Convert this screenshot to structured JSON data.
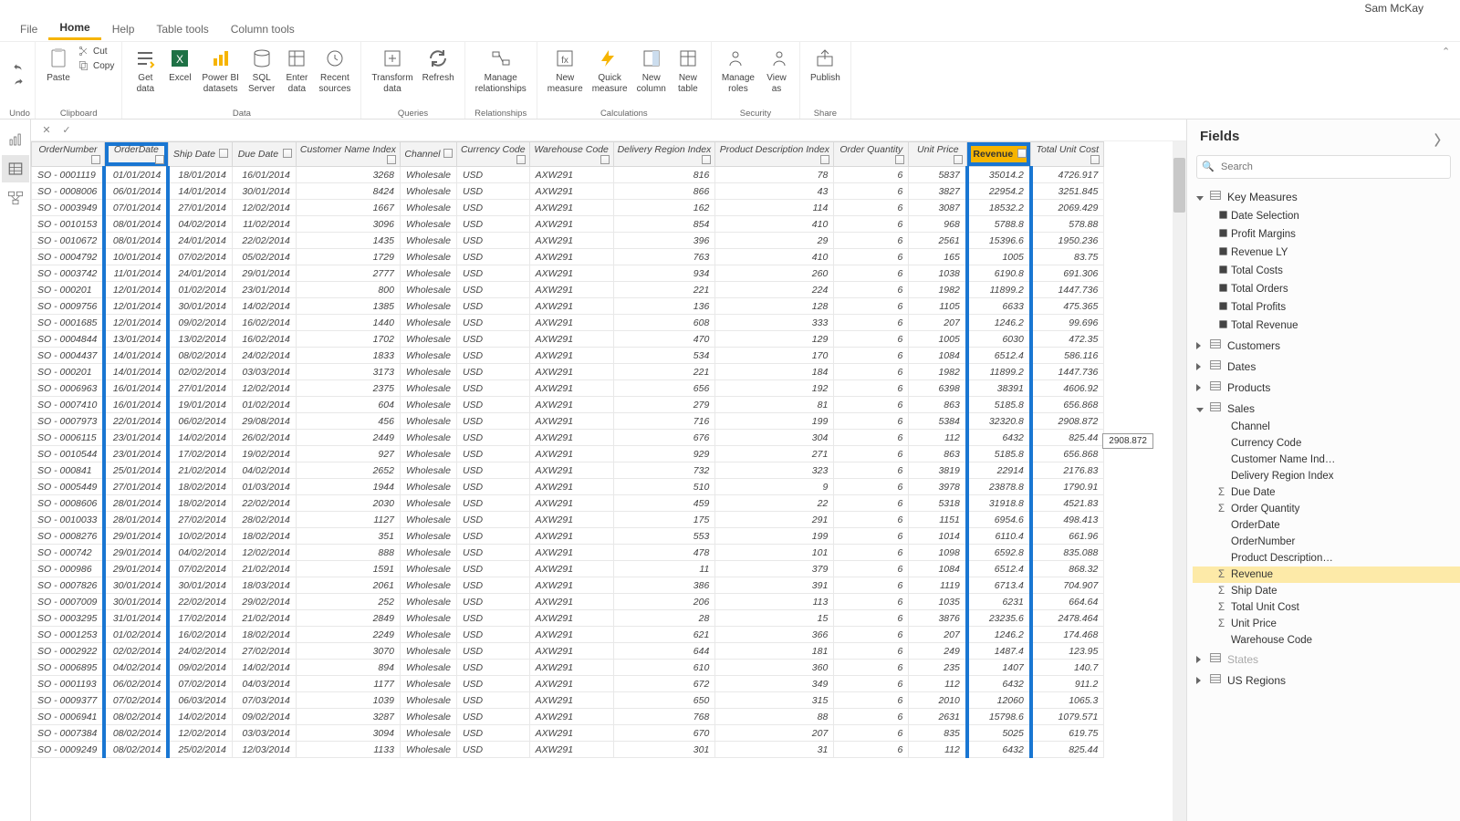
{
  "user": "Sam McKay",
  "menu": {
    "tabs": [
      "File",
      "Home",
      "Help",
      "Table tools",
      "Column tools"
    ],
    "active": 1
  },
  "ribbon": {
    "undo": {
      "label": "Undo"
    },
    "clipboard": {
      "label": "Clipboard",
      "paste": "Paste",
      "cut": "Cut",
      "copy": "Copy"
    },
    "data": {
      "label": "Data",
      "get": "Get\ndata",
      "excel": "Excel",
      "pbids": "Power BI\ndatasets",
      "sql": "SQL\nServer",
      "enter": "Enter\ndata",
      "recent": "Recent\nsources"
    },
    "queries": {
      "label": "Queries",
      "transform": "Transform\ndata",
      "refresh": "Refresh"
    },
    "rel": {
      "label": "Relationships",
      "manage": "Manage\nrelationships"
    },
    "calc": {
      "label": "Calculations",
      "nm": "New\nmeasure",
      "qm": "Quick\nmeasure",
      "nc": "New\ncolumn",
      "nt": "New\ntable"
    },
    "sec": {
      "label": "Security",
      "mr": "Manage\nroles",
      "va": "View\nas"
    },
    "share": {
      "label": "Share",
      "pub": "Publish"
    }
  },
  "fields": {
    "title": "Fields",
    "search_ph": "Search",
    "tables": [
      {
        "name": "Key Measures",
        "open": true,
        "items": [
          "Date Selection",
          "Profit Margins",
          "Revenue LY",
          "Total Costs",
          "Total Orders",
          "Total Profits",
          "Total Revenue"
        ]
      },
      {
        "name": "Customers",
        "open": false
      },
      {
        "name": "Dates",
        "open": false
      },
      {
        "name": "Products",
        "open": false
      },
      {
        "name": "Sales",
        "open": true,
        "items": [
          "Channel",
          "Currency Code",
          "Customer Name Ind…",
          "Delivery Region Index",
          "Due Date",
          "Order Quantity",
          "OrderDate",
          "OrderNumber",
          "Product Description…",
          "Revenue",
          "Ship Date",
          "Total Unit Cost",
          "Unit Price",
          "Warehouse Code"
        ],
        "sel": "Revenue",
        "sigma": [
          "Due Date",
          "Order Quantity",
          "Revenue",
          "Ship Date",
          "Total Unit Cost",
          "Unit Price"
        ]
      },
      {
        "name": "States",
        "open": false,
        "dim": true
      },
      {
        "name": "US Regions",
        "open": false
      }
    ]
  },
  "tooltip": "2908.872",
  "columns": [
    "OrderNumber",
    "OrderDate",
    "Ship Date",
    "Due Date",
    "Customer Name Index",
    "Channel",
    "Currency Code",
    "Warehouse Code",
    "Delivery Region Index",
    "Product Description Index",
    "Order Quantity",
    "Unit Price",
    "Revenue",
    "Total Unit Cost"
  ],
  "hl_cols": [
    1,
    12
  ],
  "hl_header_bg": 12,
  "chart_data": {
    "type": "table",
    "note": "raw sales rows shown in Power BI data view"
  },
  "rows": [
    [
      "SO - 0001119",
      "01/01/2014",
      "18/01/2014",
      "16/01/2014",
      "3268",
      "Wholesale",
      "USD",
      "AXW291",
      "816",
      "78",
      "6",
      "5837",
      "35014.2",
      "4726.917"
    ],
    [
      "SO - 0008006",
      "06/01/2014",
      "14/01/2014",
      "30/01/2014",
      "8424",
      "Wholesale",
      "USD",
      "AXW291",
      "866",
      "43",
      "6",
      "3827",
      "22954.2",
      "3251.845"
    ],
    [
      "SO - 0003949",
      "07/01/2014",
      "27/01/2014",
      "12/02/2014",
      "1667",
      "Wholesale",
      "USD",
      "AXW291",
      "162",
      "114",
      "6",
      "3087",
      "18532.2",
      "2069.429"
    ],
    [
      "SO - 0010153",
      "08/01/2014",
      "04/02/2014",
      "11/02/2014",
      "3096",
      "Wholesale",
      "USD",
      "AXW291",
      "854",
      "410",
      "6",
      "968",
      "5788.8",
      "578.88"
    ],
    [
      "SO - 0010672",
      "08/01/2014",
      "24/01/2014",
      "22/02/2014",
      "1435",
      "Wholesale",
      "USD",
      "AXW291",
      "396",
      "29",
      "6",
      "2561",
      "15396.6",
      "1950.236"
    ],
    [
      "SO - 0004792",
      "10/01/2014",
      "07/02/2014",
      "05/02/2014",
      "1729",
      "Wholesale",
      "USD",
      "AXW291",
      "763",
      "410",
      "6",
      "165",
      "1005",
      "83.75"
    ],
    [
      "SO - 0003742",
      "11/01/2014",
      "24/01/2014",
      "29/01/2014",
      "2777",
      "Wholesale",
      "USD",
      "AXW291",
      "934",
      "260",
      "6",
      "1038",
      "6190.8",
      "691.306"
    ],
    [
      "SO - 000201",
      "12/01/2014",
      "01/02/2014",
      "23/01/2014",
      "800",
      "Wholesale",
      "USD",
      "AXW291",
      "221",
      "224",
      "6",
      "1982",
      "11899.2",
      "1447.736"
    ],
    [
      "SO - 0009756",
      "12/01/2014",
      "30/01/2014",
      "14/02/2014",
      "1385",
      "Wholesale",
      "USD",
      "AXW291",
      "136",
      "128",
      "6",
      "1105",
      "6633",
      "475.365"
    ],
    [
      "SO - 0001685",
      "12/01/2014",
      "09/02/2014",
      "16/02/2014",
      "1440",
      "Wholesale",
      "USD",
      "AXW291",
      "608",
      "333",
      "6",
      "207",
      "1246.2",
      "99.696"
    ],
    [
      "SO - 0004844",
      "13/01/2014",
      "13/02/2014",
      "16/02/2014",
      "1702",
      "Wholesale",
      "USD",
      "AXW291",
      "470",
      "129",
      "6",
      "1005",
      "6030",
      "472.35"
    ],
    [
      "SO - 0004437",
      "14/01/2014",
      "08/02/2014",
      "24/02/2014",
      "1833",
      "Wholesale",
      "USD",
      "AXW291",
      "534",
      "170",
      "6",
      "1084",
      "6512.4",
      "586.116"
    ],
    [
      "SO - 000201",
      "14/01/2014",
      "02/02/2014",
      "03/03/2014",
      "3173",
      "Wholesale",
      "USD",
      "AXW291",
      "221",
      "184",
      "6",
      "1982",
      "11899.2",
      "1447.736"
    ],
    [
      "SO - 0006963",
      "16/01/2014",
      "27/01/2014",
      "12/02/2014",
      "2375",
      "Wholesale",
      "USD",
      "AXW291",
      "656",
      "192",
      "6",
      "6398",
      "38391",
      "4606.92"
    ],
    [
      "SO - 0007410",
      "16/01/2014",
      "19/01/2014",
      "01/02/2014",
      "604",
      "Wholesale",
      "USD",
      "AXW291",
      "279",
      "81",
      "6",
      "863",
      "5185.8",
      "656.868"
    ],
    [
      "SO - 0007973",
      "22/01/2014",
      "06/02/2014",
      "29/08/2014",
      "456",
      "Wholesale",
      "USD",
      "AXW291",
      "716",
      "199",
      "6",
      "5384",
      "32320.8",
      "2908.872"
    ],
    [
      "SO - 0006115",
      "23/01/2014",
      "14/02/2014",
      "26/02/2014",
      "2449",
      "Wholesale",
      "USD",
      "AXW291",
      "676",
      "304",
      "6",
      "112",
      "6432",
      "825.44"
    ],
    [
      "SO - 0010544",
      "23/01/2014",
      "17/02/2014",
      "19/02/2014",
      "927",
      "Wholesale",
      "USD",
      "AXW291",
      "929",
      "271",
      "6",
      "863",
      "5185.8",
      "656.868"
    ],
    [
      "SO - 000841",
      "25/01/2014",
      "21/02/2014",
      "04/02/2014",
      "2652",
      "Wholesale",
      "USD",
      "AXW291",
      "732",
      "323",
      "6",
      "3819",
      "22914",
      "2176.83"
    ],
    [
      "SO - 0005449",
      "27/01/2014",
      "18/02/2014",
      "01/03/2014",
      "1944",
      "Wholesale",
      "USD",
      "AXW291",
      "510",
      "9",
      "6",
      "3978",
      "23878.8",
      "1790.91"
    ],
    [
      "SO - 0008606",
      "28/01/2014",
      "18/02/2014",
      "22/02/2014",
      "2030",
      "Wholesale",
      "USD",
      "AXW291",
      "459",
      "22",
      "6",
      "5318",
      "31918.8",
      "4521.83"
    ],
    [
      "SO - 0010033",
      "28/01/2014",
      "27/02/2014",
      "28/02/2014",
      "1127",
      "Wholesale",
      "USD",
      "AXW291",
      "175",
      "291",
      "6",
      "1151",
      "6954.6",
      "498.413"
    ],
    [
      "SO - 0008276",
      "29/01/2014",
      "10/02/2014",
      "18/02/2014",
      "351",
      "Wholesale",
      "USD",
      "AXW291",
      "553",
      "199",
      "6",
      "1014",
      "6110.4",
      "661.96"
    ],
    [
      "SO - 000742",
      "29/01/2014",
      "04/02/2014",
      "12/02/2014",
      "888",
      "Wholesale",
      "USD",
      "AXW291",
      "478",
      "101",
      "6",
      "1098",
      "6592.8",
      "835.088"
    ],
    [
      "SO - 000986",
      "29/01/2014",
      "07/02/2014",
      "21/02/2014",
      "1591",
      "Wholesale",
      "USD",
      "AXW291",
      "11",
      "379",
      "6",
      "1084",
      "6512.4",
      "868.32"
    ],
    [
      "SO - 0007826",
      "30/01/2014",
      "30/01/2014",
      "18/03/2014",
      "2061",
      "Wholesale",
      "USD",
      "AXW291",
      "386",
      "391",
      "6",
      "1119",
      "6713.4",
      "704.907"
    ],
    [
      "SO - 0007009",
      "30/01/2014",
      "22/02/2014",
      "29/02/2014",
      "252",
      "Wholesale",
      "USD",
      "AXW291",
      "206",
      "113",
      "6",
      "1035",
      "6231",
      "664.64"
    ],
    [
      "SO - 0003295",
      "31/01/2014",
      "17/02/2014",
      "21/02/2014",
      "2849",
      "Wholesale",
      "USD",
      "AXW291",
      "28",
      "15",
      "6",
      "3876",
      "23235.6",
      "2478.464"
    ],
    [
      "SO - 0001253",
      "01/02/2014",
      "16/02/2014",
      "18/02/2014",
      "2249",
      "Wholesale",
      "USD",
      "AXW291",
      "621",
      "366",
      "6",
      "207",
      "1246.2",
      "174.468"
    ],
    [
      "SO - 0002922",
      "02/02/2014",
      "24/02/2014",
      "27/02/2014",
      "3070",
      "Wholesale",
      "USD",
      "AXW291",
      "644",
      "181",
      "6",
      "249",
      "1487.4",
      "123.95"
    ],
    [
      "SO - 0006895",
      "04/02/2014",
      "09/02/2014",
      "14/02/2014",
      "894",
      "Wholesale",
      "USD",
      "AXW291",
      "610",
      "360",
      "6",
      "235",
      "1407",
      "140.7"
    ],
    [
      "SO - 0001193",
      "06/02/2014",
      "07/02/2014",
      "04/03/2014",
      "1177",
      "Wholesale",
      "USD",
      "AXW291",
      "672",
      "349",
      "6",
      "112",
      "6432",
      "911.2"
    ],
    [
      "SO - 0009377",
      "07/02/2014",
      "06/03/2014",
      "07/03/2014",
      "1039",
      "Wholesale",
      "USD",
      "AXW291",
      "650",
      "315",
      "6",
      "2010",
      "12060",
      "1065.3"
    ],
    [
      "SO - 0006941",
      "08/02/2014",
      "14/02/2014",
      "09/02/2014",
      "3287",
      "Wholesale",
      "USD",
      "AXW291",
      "768",
      "88",
      "6",
      "2631",
      "15798.6",
      "1079.571"
    ],
    [
      "SO - 0007384",
      "08/02/2014",
      "12/02/2014",
      "03/03/2014",
      "3094",
      "Wholesale",
      "USD",
      "AXW291",
      "670",
      "207",
      "6",
      "835",
      "5025",
      "619.75"
    ],
    [
      "SO - 0009249",
      "08/02/2014",
      "25/02/2014",
      "12/03/2014",
      "1133",
      "Wholesale",
      "USD",
      "AXW291",
      "301",
      "31",
      "6",
      "112",
      "6432",
      "825.44"
    ]
  ]
}
